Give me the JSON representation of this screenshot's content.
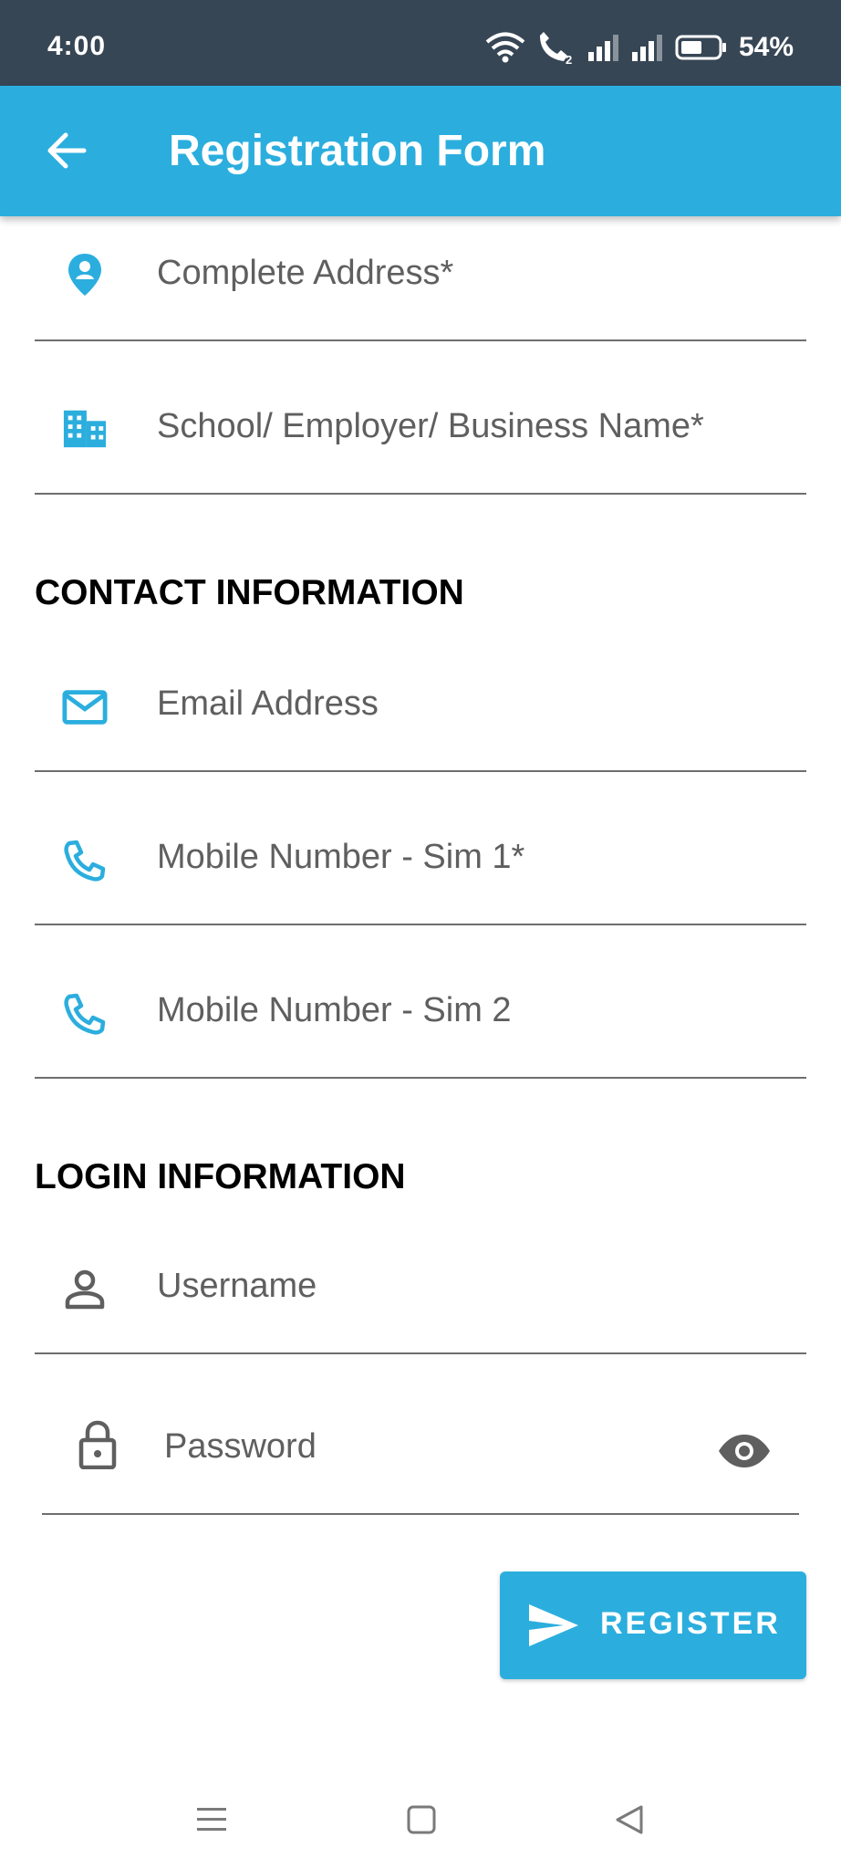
{
  "status_bar": {
    "time": "4:00",
    "battery": "54%",
    "icons": [
      "wifi-icon",
      "wifi-calling-icon",
      "signal-icon",
      "signal-icon",
      "battery-icon"
    ]
  },
  "app_bar": {
    "title": "Registration Form",
    "back_icon": "arrow-left-icon",
    "background": "#2BAEDE"
  },
  "form": {
    "address": {
      "label": "Complete Address*",
      "icon": "location-pin-icon"
    },
    "business": {
      "label": "School/ Employer/ Business Name*",
      "icon": "building-icon"
    },
    "contact_heading": "CONTACT INFORMATION",
    "email": {
      "label": "Email Address",
      "icon": "mail-icon"
    },
    "mobile1": {
      "label": "Mobile Number - Sim 1*",
      "icon": "phone-icon"
    },
    "mobile2": {
      "label": "Mobile Number - Sim 2",
      "icon": "phone-icon"
    },
    "login_heading": "LOGIN INFORMATION",
    "username": {
      "label": "Username",
      "icon": "person-icon"
    },
    "password": {
      "label": "Password",
      "icon": "lock-icon",
      "toggle_icon": "eye-icon"
    }
  },
  "register_button": {
    "label": "REGISTER",
    "icon": "send-icon"
  },
  "nav_bar": {
    "icons": [
      "menu-icon",
      "home-square-icon",
      "back-triangle-icon"
    ]
  },
  "colors": {
    "accent": "#2BAEDE",
    "status_bar": "#374655",
    "divider": "#6e6e6e",
    "icon_gray": "#5f5f5f"
  }
}
